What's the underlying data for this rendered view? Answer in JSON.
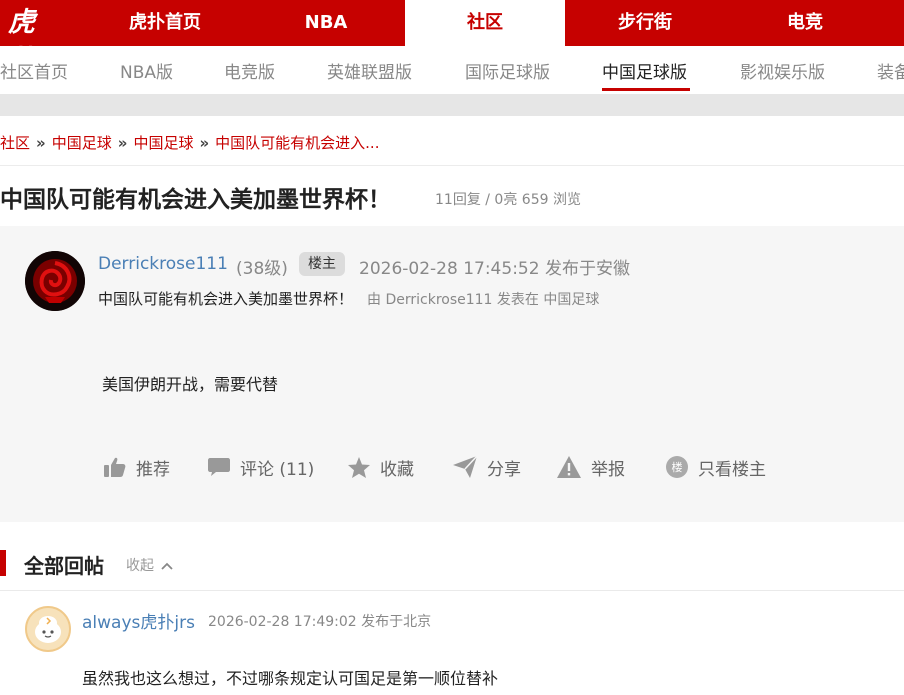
{
  "logo": {
    "text": "虎扑"
  },
  "topnav": {
    "items": [
      {
        "label": "虎扑首页"
      },
      {
        "label": "NBA"
      },
      {
        "label": "社区"
      },
      {
        "label": "步行街"
      },
      {
        "label": "电竞"
      }
    ],
    "active": "社区"
  },
  "subnav": {
    "items": [
      {
        "label": "社区首页"
      },
      {
        "label": "NBA版"
      },
      {
        "label": "电竞版"
      },
      {
        "label": "英雄联盟版"
      },
      {
        "label": "国际足球版"
      },
      {
        "label": "中国足球版"
      },
      {
        "label": "影视娱乐版"
      },
      {
        "label": "装备"
      }
    ],
    "active": "中国足球版"
  },
  "breadcrumb": {
    "items": [
      "社区",
      "中国足球",
      "中国足球",
      "中国队可能有机会进入..."
    ],
    "separator": "»"
  },
  "thread": {
    "title": "中国队可能有机会进入美加墨世界杯！",
    "stats": "11回复 / 0亮 659 浏览"
  },
  "post": {
    "author": "Derrickrose111",
    "level": "(38级)",
    "owner_badge": "楼主",
    "time": "2026-02-28 17:45:52",
    "location": "发布于安徽",
    "sub_title": "中国队可能有机会进入美加墨世界杯！",
    "sub_meta": "由  Derrickrose111 发表在  中国足球",
    "body": "美国伊朗开战，需要代替"
  },
  "actions": [
    {
      "label": "推荐",
      "icon": "thumbs-up-icon"
    },
    {
      "label": "评论 (11)",
      "icon": "comment-icon"
    },
    {
      "label": "收藏",
      "icon": "star-icon"
    },
    {
      "label": "分享",
      "icon": "share-icon"
    },
    {
      "label": "举报",
      "icon": "warning-icon"
    },
    {
      "label": "只看楼主",
      "icon": "owner-icon",
      "icon_text": "楼"
    }
  ],
  "replies": {
    "header": "全部回帖",
    "collapse_label": "收起",
    "items": [
      {
        "author": "always虎扑jrs",
        "time": "2026-02-28 17:49:02",
        "location": "发布于北京",
        "body": "虽然我也这么想过，不过哪条规定认可国足是第一顺位替补"
      }
    ]
  },
  "colors": {
    "brand_red": "#c60100",
    "link_blue": "#4a7fb5",
    "muted_gray": "#888888",
    "post_bg": "#f6f6f6"
  }
}
